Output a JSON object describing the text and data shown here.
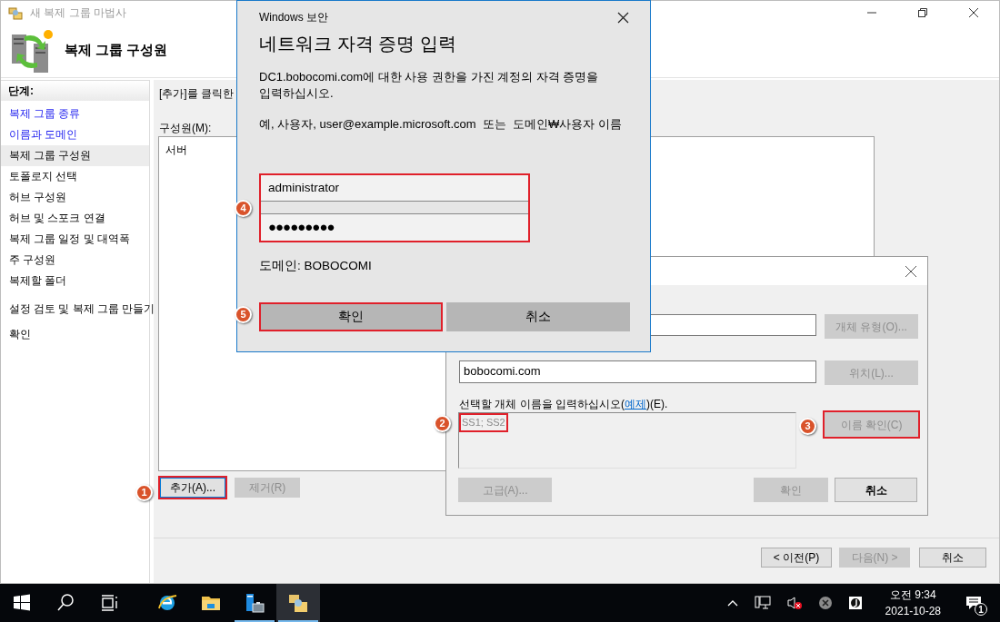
{
  "wizard": {
    "title": "새 복제 그룹 마법사",
    "heading": "복제 그룹 구성원",
    "steps_header": "단계:",
    "steps": [
      {
        "label": "복제 그룹 종류",
        "completed": true,
        "selected": false
      },
      {
        "label": "이름과 도메인",
        "completed": true,
        "selected": false
      },
      {
        "label": "복제 그룹 구성원",
        "completed": false,
        "selected": true
      },
      {
        "label": "토폴로지 선택",
        "completed": false,
        "selected": false
      },
      {
        "label": "허브 구성원",
        "completed": false,
        "selected": false
      },
      {
        "label": "허브 및 스포크 연결",
        "completed": false,
        "selected": false
      },
      {
        "label": "복제 그룹 일정 및 대역폭",
        "completed": false,
        "selected": false
      },
      {
        "label": "주 구성원",
        "completed": false,
        "selected": false
      },
      {
        "label": "복제할 폴더",
        "completed": false,
        "selected": false
      },
      {
        "label": "설정 검토 및 복제 그룹 만들기",
        "completed": false,
        "selected": false
      },
      {
        "label": "확인",
        "completed": false,
        "selected": false
      }
    ],
    "intro": "[추가]를 클릭한",
    "members_label": "구성원(M):",
    "members_column": "서버",
    "list_buttons": [
      {
        "label": "추가(A)...",
        "disabled": false,
        "highlighted": true
      },
      {
        "label": "제거(R)",
        "disabled": true,
        "highlighted": false
      }
    ],
    "nav_buttons": [
      {
        "label": "< 이전(P)",
        "disabled": false
      },
      {
        "label": "다음(N) >",
        "disabled": true
      },
      {
        "label": "취소",
        "disabled": false
      }
    ]
  },
  "select_dialog": {
    "object_type_button": {
      "label": "개체 유형(O)...",
      "disabled": true
    },
    "location_value": "bobocomi.com",
    "location_button": {
      "label": "위치(L)...",
      "disabled": true
    },
    "names_label_before": "선택할 개체 이름을 입력하십시오(",
    "names_link": "예제",
    "names_label_after": ")(E).",
    "names_value": "SS1; SS2",
    "names_highlighted": true,
    "check_names_button": {
      "label": "이름 확인(C)",
      "disabled": true,
      "highlighted": true
    },
    "buttons": [
      {
        "label": "고급(A)...",
        "disabled": true
      },
      {
        "label": "확인",
        "disabled": true
      },
      {
        "label": "취소",
        "disabled": false
      }
    ]
  },
  "security_dialog": {
    "caption": "Windows 보안",
    "title": "네트워크 자격 증명 입력",
    "message": "DC1.bobocomi.com에 대한 사용 권한을 가진 계정의 자격 증명을 입력하십시오.",
    "example": "예, 사용자, user@example.microsoft.com  또는  도메인₩사용자 이름",
    "username": "administrator",
    "password_mask": "●●●●●●●●●",
    "credentials_highlighted": true,
    "domain": "도메인: BOBOCOMI",
    "buttons": [
      {
        "label": "확인",
        "highlighted": true
      },
      {
        "label": "취소",
        "highlighted": false
      }
    ]
  },
  "callouts": [
    {
      "number": "1"
    },
    {
      "number": "2"
    },
    {
      "number": "3"
    },
    {
      "number": "4"
    },
    {
      "number": "5"
    }
  ],
  "taskbar": {
    "apps": [
      {
        "kind": "ie",
        "running": false,
        "active": false
      },
      {
        "kind": "explorer",
        "running": false,
        "active": false
      },
      {
        "kind": "server",
        "running": true,
        "active": false
      },
      {
        "kind": "dfs",
        "running": true,
        "active": true
      }
    ],
    "time": "오전 9:34",
    "date": "2021-10-28",
    "notifications": "1"
  }
}
